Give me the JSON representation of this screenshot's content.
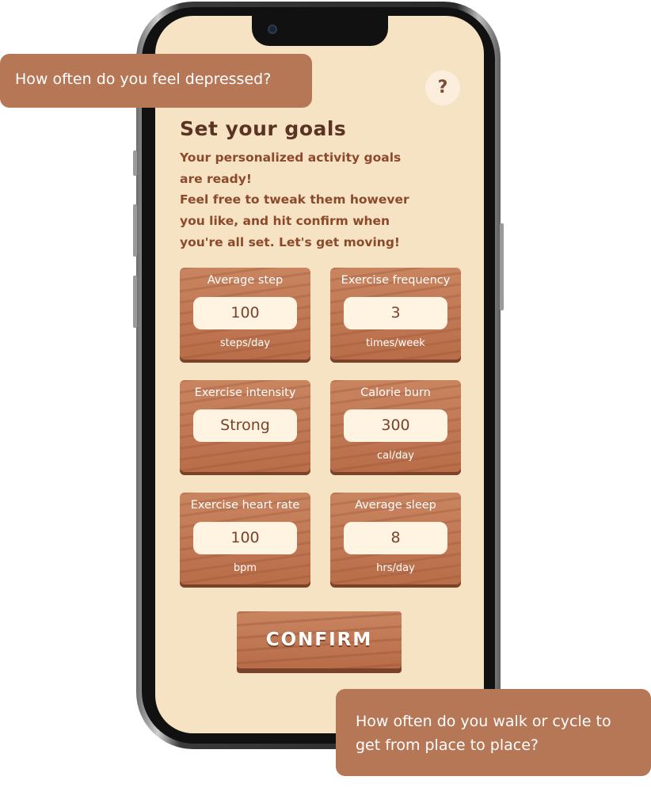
{
  "help_label": "?",
  "title": "Set your goals",
  "intro_lines": [
    "Your personalized activity goals",
    "are ready!",
    "Feel free to tweak them however",
    "you like, and hit confirm when",
    "you're all set. Let's get moving!"
  ],
  "goals": [
    {
      "label": "Average step",
      "value": "100",
      "unit": "steps/day"
    },
    {
      "label": "Exercise frequency",
      "value": "3",
      "unit": "times/week"
    },
    {
      "label": "Exercise intensity",
      "value": "Strong",
      "unit": ""
    },
    {
      "label": "Calorie burn",
      "value": "300",
      "unit": "cal/day"
    },
    {
      "label": "Exercise heart rate",
      "value": "100",
      "unit": "bpm"
    },
    {
      "label": "Average sleep",
      "value": "8",
      "unit": "hrs/day"
    }
  ],
  "confirm_label": "CONFIRM",
  "bubbles": {
    "left": "How often do you feel depressed?",
    "right": "How often do you walk or cycle to get from place to place?"
  },
  "colors": {
    "screen_bg": "#f6e3c4",
    "wood": "#c67b55",
    "dark_text": "#5b3323",
    "intro_text": "#8b4a2b",
    "bubble": "#b67757"
  }
}
